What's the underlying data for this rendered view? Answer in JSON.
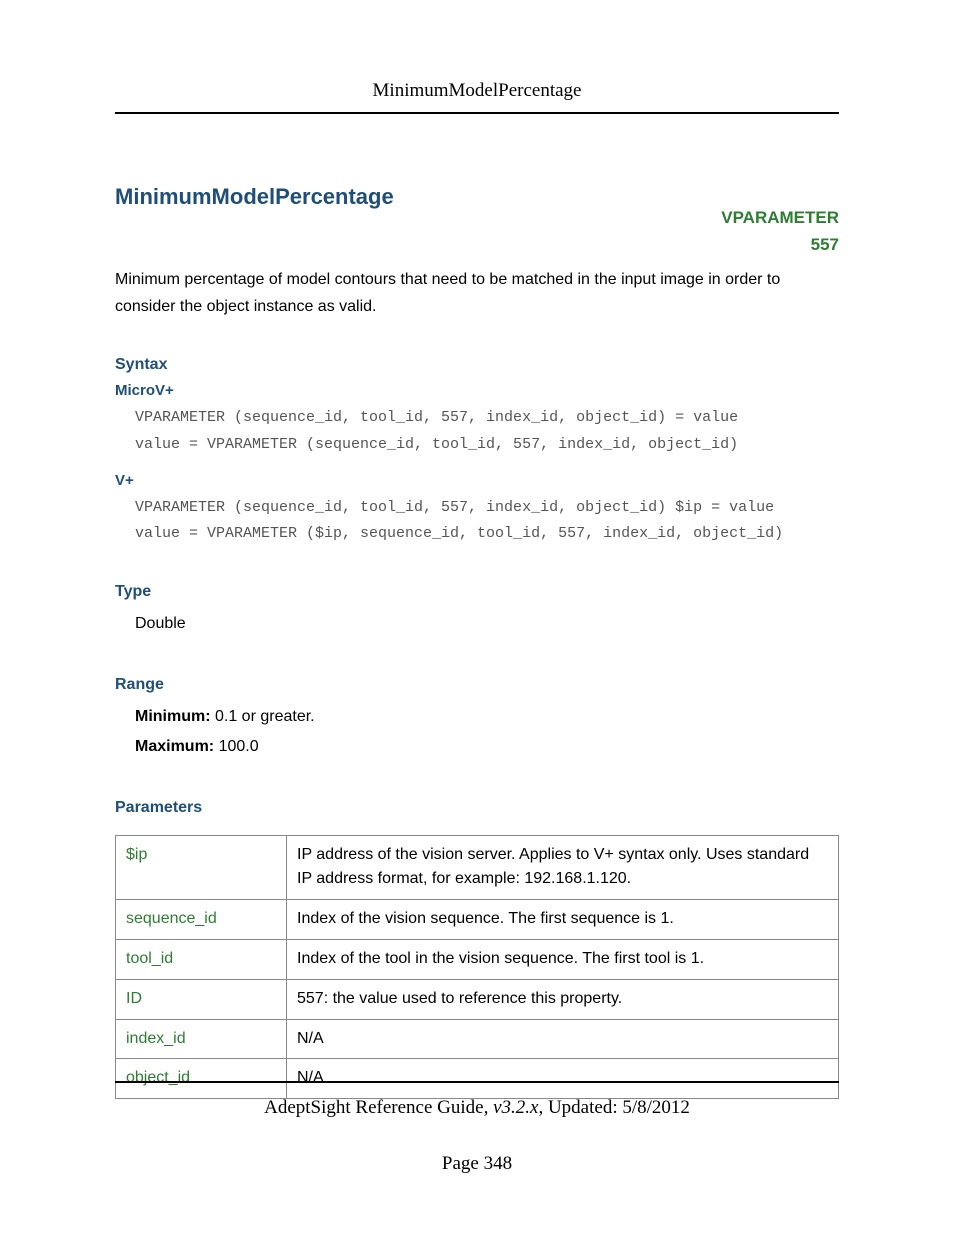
{
  "header": {
    "running_title": "MinimumModelPercentage"
  },
  "title": "MinimumModelPercentage",
  "tag": {
    "name": "VPARAMETER",
    "id": "557"
  },
  "intro": "Minimum percentage of model contours that need to be matched in the input image in order to consider the object instance as valid.",
  "sections": {
    "syntax": {
      "heading": "Syntax",
      "microv": {
        "label": "MicroV+",
        "lines": [
          "VPARAMETER (sequence_id, tool_id, 557, index_id, object_id) = value",
          "value = VPARAMETER (sequence_id, tool_id, 557, index_id, object_id)"
        ]
      },
      "vplus": {
        "label": "V+",
        "lines": [
          "VPARAMETER (sequence_id, tool_id, 557, index_id, object_id) $ip = value",
          "value = VPARAMETER ($ip, sequence_id, tool_id, 557, index_id, object_id)"
        ]
      }
    },
    "type": {
      "heading": "Type",
      "value": "Double"
    },
    "range": {
      "heading": "Range",
      "min_label": "Minimum:",
      "min_value": " 0.1 or greater.",
      "max_label": "Maximum:",
      "max_value": " 100.0"
    },
    "parameters": {
      "heading": "Parameters",
      "rows": [
        {
          "name": "$ip",
          "desc": "IP address of the vision server. Applies to V+ syntax only. Uses standard IP address format, for example: 192.168.1.120."
        },
        {
          "name": "sequence_id",
          "desc": "Index of the vision sequence. The first sequence is 1."
        },
        {
          "name": "tool_id",
          "desc": "Index of the tool in the vision sequence. The first tool is 1."
        },
        {
          "name": "ID",
          "desc": "557: the value used to reference this property."
        },
        {
          "name": "index_id",
          "desc": "N/A"
        },
        {
          "name": "object_id",
          "desc": "N/A"
        }
      ]
    }
  },
  "footer": {
    "guide": "AdeptSight Reference Guide",
    "version": ", v3.2.x",
    "updated": ", Updated: 5/8/2012",
    "page_label": "Page 348"
  }
}
